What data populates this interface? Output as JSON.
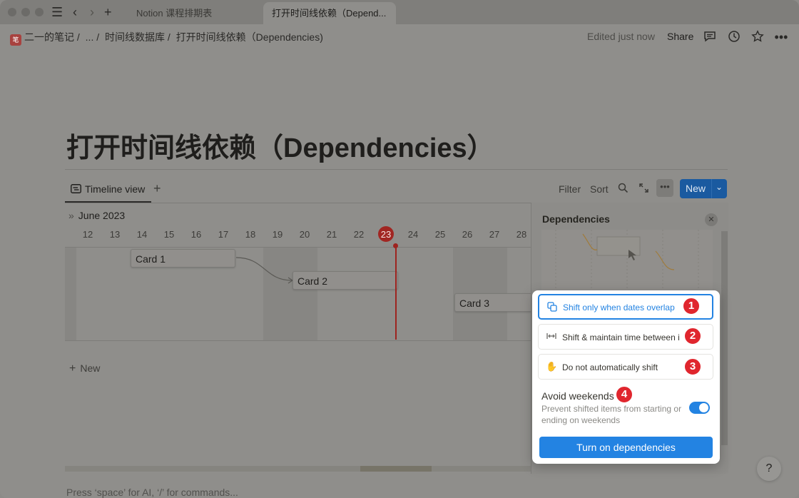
{
  "tabs": [
    {
      "label": "Notion 课程排期表"
    },
    {
      "label": "打开时间线依赖（Depend..."
    }
  ],
  "breadcrumb": {
    "workspace_icon": "笔",
    "items": [
      "二一的笔记 /",
      "... /",
      "时间线数据库 /",
      "打开时间线依赖（Dependencies)"
    ]
  },
  "topbar": {
    "edited": "Edited just now",
    "share": "Share"
  },
  "page": {
    "title": "打开时间线依赖（Dependencies）"
  },
  "views": {
    "active_label": "Timeline view",
    "add": "+",
    "filter": "Filter",
    "sort": "Sort",
    "new_label": "New"
  },
  "timeline": {
    "month": "June 2023",
    "days": [
      "12",
      "13",
      "14",
      "15",
      "16",
      "17",
      "18",
      "19",
      "20",
      "21",
      "22",
      "23",
      "24",
      "25",
      "26",
      "27",
      "28"
    ],
    "today": "23",
    "cards": [
      {
        "label": "Card 1"
      },
      {
        "label": "Card 2"
      },
      {
        "label": "Card 3"
      }
    ],
    "add_new": "New"
  },
  "dependencies_panel": {
    "title": "Dependencies"
  },
  "popup": {
    "options": [
      {
        "label": "Shift only when dates overlap",
        "badge": "1",
        "icon": "overlap-icon"
      },
      {
        "label": "Shift & maintain time between i",
        "badge": "2",
        "icon": "maintain-gap-icon"
      },
      {
        "label": "Do not automatically shift",
        "badge": "3",
        "icon": "hand-icon"
      }
    ],
    "avoid_weekends": {
      "title": "Avoid weekends",
      "badge": "4",
      "description": "Prevent shifted items from starting or ending on weekends",
      "enabled": true
    },
    "button": "Turn on dependencies"
  },
  "footer": {
    "hint": "Press ‘space’ for AI, ‘/’ for commands..."
  },
  "help": "?",
  "colors": {
    "accent": "#2383e2",
    "badge_red": "#e0262e",
    "today_red": "#9e2420"
  }
}
